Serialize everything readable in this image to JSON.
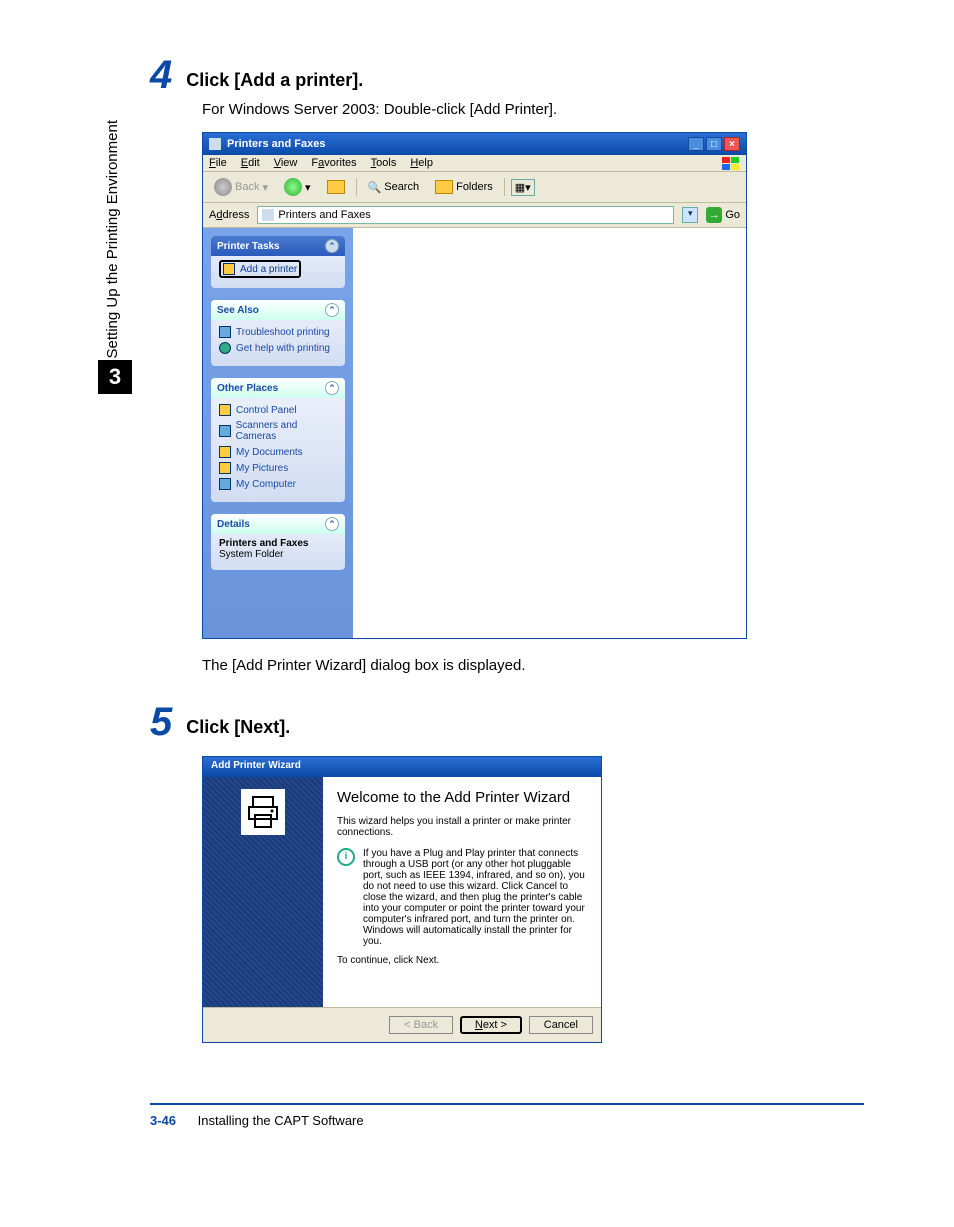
{
  "sidebar": {
    "chapter": "3",
    "side_text": "Setting Up the Printing Environment"
  },
  "footer": {
    "page_num": "3-46",
    "section": "Installing the CAPT Software"
  },
  "step4": {
    "num": "4",
    "title": "Click [Add a printer].",
    "sub": "For Windows Server 2003: Double-click [Add Printer].",
    "after": "The [Add Printer Wizard] dialog box is displayed."
  },
  "step5": {
    "num": "5",
    "title": "Click [Next]."
  },
  "xp": {
    "title": "Printers and Faxes",
    "menu": {
      "file": "File",
      "edit": "Edit",
      "view": "View",
      "favorites": "Favorites",
      "tools": "Tools",
      "help": "Help"
    },
    "toolbar": {
      "back": "Back",
      "search": "Search",
      "folders": "Folders"
    },
    "address_label": "Address",
    "address_value": "Printers and Faxes",
    "go": "Go",
    "panel_tasks": {
      "header": "Printer Tasks",
      "add_printer": "Add a printer"
    },
    "panel_seealso": {
      "header": "See Also",
      "troubleshoot": "Troubleshoot printing",
      "get_help": "Get help with printing"
    },
    "panel_other": {
      "header": "Other Places",
      "control_panel": "Control Panel",
      "scanners": "Scanners and Cameras",
      "my_docs": "My Documents",
      "my_pics": "My Pictures",
      "my_comp": "My Computer"
    },
    "panel_details": {
      "header": "Details",
      "line1": "Printers and Faxes",
      "line2": "System Folder"
    }
  },
  "wizard": {
    "title": "Add Printer Wizard",
    "heading": "Welcome to the Add Printer Wizard",
    "intro": "This wizard helps you install a printer or make printer connections.",
    "info": "If you have a Plug and Play printer that connects through a USB port (or any other hot pluggable port, such as IEEE 1394, infrared, and so on), you do not need to use this wizard. Click Cancel to close the wizard, and then plug the printer's cable into your computer or point the printer toward your computer's infrared port, and turn the printer on. Windows will automatically install the printer for you.",
    "continue": "To continue, click Next.",
    "btn_back": "< Back",
    "btn_next": "Next >",
    "btn_cancel": "Cancel"
  }
}
